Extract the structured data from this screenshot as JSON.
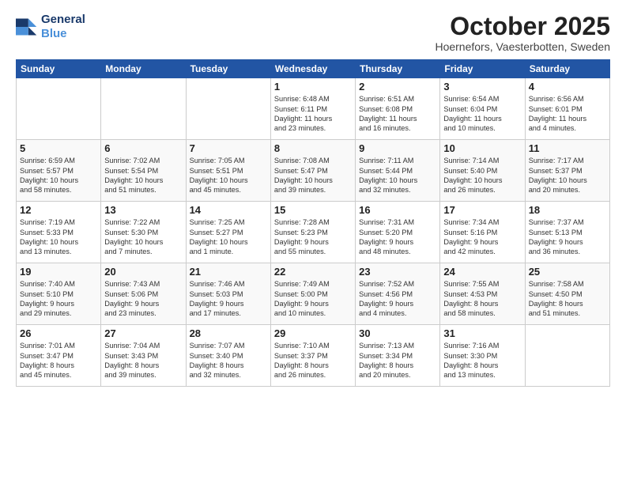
{
  "header": {
    "logo_line1": "General",
    "logo_line2": "Blue",
    "month": "October 2025",
    "location": "Hoernefors, Vaesterbotten, Sweden"
  },
  "weekdays": [
    "Sunday",
    "Monday",
    "Tuesday",
    "Wednesday",
    "Thursday",
    "Friday",
    "Saturday"
  ],
  "weeks": [
    [
      {
        "day": "",
        "info": ""
      },
      {
        "day": "",
        "info": ""
      },
      {
        "day": "",
        "info": ""
      },
      {
        "day": "1",
        "info": "Sunrise: 6:48 AM\nSunset: 6:11 PM\nDaylight: 11 hours\nand 23 minutes."
      },
      {
        "day": "2",
        "info": "Sunrise: 6:51 AM\nSunset: 6:08 PM\nDaylight: 11 hours\nand 16 minutes."
      },
      {
        "day": "3",
        "info": "Sunrise: 6:54 AM\nSunset: 6:04 PM\nDaylight: 11 hours\nand 10 minutes."
      },
      {
        "day": "4",
        "info": "Sunrise: 6:56 AM\nSunset: 6:01 PM\nDaylight: 11 hours\nand 4 minutes."
      }
    ],
    [
      {
        "day": "5",
        "info": "Sunrise: 6:59 AM\nSunset: 5:57 PM\nDaylight: 10 hours\nand 58 minutes."
      },
      {
        "day": "6",
        "info": "Sunrise: 7:02 AM\nSunset: 5:54 PM\nDaylight: 10 hours\nand 51 minutes."
      },
      {
        "day": "7",
        "info": "Sunrise: 7:05 AM\nSunset: 5:51 PM\nDaylight: 10 hours\nand 45 minutes."
      },
      {
        "day": "8",
        "info": "Sunrise: 7:08 AM\nSunset: 5:47 PM\nDaylight: 10 hours\nand 39 minutes."
      },
      {
        "day": "9",
        "info": "Sunrise: 7:11 AM\nSunset: 5:44 PM\nDaylight: 10 hours\nand 32 minutes."
      },
      {
        "day": "10",
        "info": "Sunrise: 7:14 AM\nSunset: 5:40 PM\nDaylight: 10 hours\nand 26 minutes."
      },
      {
        "day": "11",
        "info": "Sunrise: 7:17 AM\nSunset: 5:37 PM\nDaylight: 10 hours\nand 20 minutes."
      }
    ],
    [
      {
        "day": "12",
        "info": "Sunrise: 7:19 AM\nSunset: 5:33 PM\nDaylight: 10 hours\nand 13 minutes."
      },
      {
        "day": "13",
        "info": "Sunrise: 7:22 AM\nSunset: 5:30 PM\nDaylight: 10 hours\nand 7 minutes."
      },
      {
        "day": "14",
        "info": "Sunrise: 7:25 AM\nSunset: 5:27 PM\nDaylight: 10 hours\nand 1 minute."
      },
      {
        "day": "15",
        "info": "Sunrise: 7:28 AM\nSunset: 5:23 PM\nDaylight: 9 hours\nand 55 minutes."
      },
      {
        "day": "16",
        "info": "Sunrise: 7:31 AM\nSunset: 5:20 PM\nDaylight: 9 hours\nand 48 minutes."
      },
      {
        "day": "17",
        "info": "Sunrise: 7:34 AM\nSunset: 5:16 PM\nDaylight: 9 hours\nand 42 minutes."
      },
      {
        "day": "18",
        "info": "Sunrise: 7:37 AM\nSunset: 5:13 PM\nDaylight: 9 hours\nand 36 minutes."
      }
    ],
    [
      {
        "day": "19",
        "info": "Sunrise: 7:40 AM\nSunset: 5:10 PM\nDaylight: 9 hours\nand 29 minutes."
      },
      {
        "day": "20",
        "info": "Sunrise: 7:43 AM\nSunset: 5:06 PM\nDaylight: 9 hours\nand 23 minutes."
      },
      {
        "day": "21",
        "info": "Sunrise: 7:46 AM\nSunset: 5:03 PM\nDaylight: 9 hours\nand 17 minutes."
      },
      {
        "day": "22",
        "info": "Sunrise: 7:49 AM\nSunset: 5:00 PM\nDaylight: 9 hours\nand 10 minutes."
      },
      {
        "day": "23",
        "info": "Sunrise: 7:52 AM\nSunset: 4:56 PM\nDaylight: 9 hours\nand 4 minutes."
      },
      {
        "day": "24",
        "info": "Sunrise: 7:55 AM\nSunset: 4:53 PM\nDaylight: 8 hours\nand 58 minutes."
      },
      {
        "day": "25",
        "info": "Sunrise: 7:58 AM\nSunset: 4:50 PM\nDaylight: 8 hours\nand 51 minutes."
      }
    ],
    [
      {
        "day": "26",
        "info": "Sunrise: 7:01 AM\nSunset: 3:47 PM\nDaylight: 8 hours\nand 45 minutes."
      },
      {
        "day": "27",
        "info": "Sunrise: 7:04 AM\nSunset: 3:43 PM\nDaylight: 8 hours\nand 39 minutes."
      },
      {
        "day": "28",
        "info": "Sunrise: 7:07 AM\nSunset: 3:40 PM\nDaylight: 8 hours\nand 32 minutes."
      },
      {
        "day": "29",
        "info": "Sunrise: 7:10 AM\nSunset: 3:37 PM\nDaylight: 8 hours\nand 26 minutes."
      },
      {
        "day": "30",
        "info": "Sunrise: 7:13 AM\nSunset: 3:34 PM\nDaylight: 8 hours\nand 20 minutes."
      },
      {
        "day": "31",
        "info": "Sunrise: 7:16 AM\nSunset: 3:30 PM\nDaylight: 8 hours\nand 13 minutes."
      },
      {
        "day": "",
        "info": ""
      }
    ]
  ]
}
